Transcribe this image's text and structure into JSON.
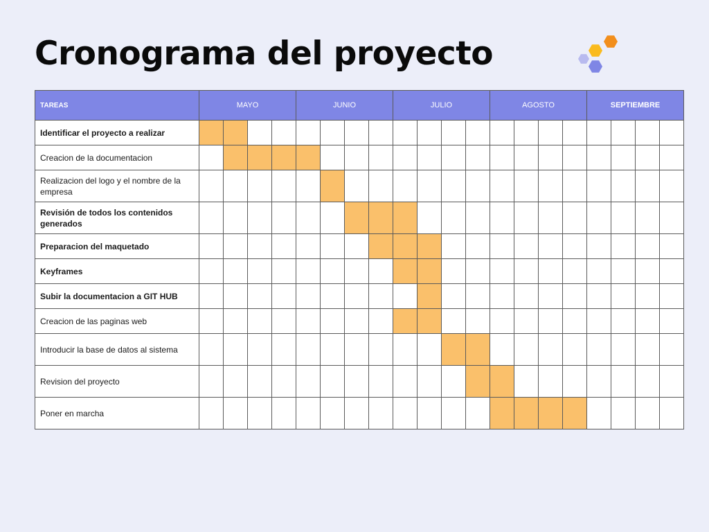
{
  "title": "Cronograma del proyecto",
  "colors": {
    "background": "#ECEEF9",
    "header": "#7F86E5",
    "bar": "#FAC06B",
    "logo_hexes": [
      "#F28E1C",
      "#FABB1E",
      "#B8BAEF",
      "#7F86E5"
    ]
  },
  "table": {
    "task_header": "TAREAS",
    "months": [
      {
        "label": "MAYO",
        "bold": false
      },
      {
        "label": "JUNIO",
        "bold": false
      },
      {
        "label": "JULIO",
        "bold": false
      },
      {
        "label": "AGOSTO",
        "bold": false
      },
      {
        "label": "SEPTIEMBRE",
        "bold": true
      }
    ],
    "weeks_per_month": 4,
    "rows": [
      {
        "task": "Identificar el proyecto a realizar",
        "bold": true,
        "weeks": [
          1,
          2
        ]
      },
      {
        "task": "Creacion de la documentacion",
        "bold": false,
        "weeks": [
          2,
          3,
          4,
          5
        ]
      },
      {
        "task": "Realizacion del logo y el nombre de la empresa",
        "bold": false,
        "weeks": [
          6
        ]
      },
      {
        "task": "Revisión de todos los  contenidos generados",
        "bold": true,
        "weeks": [
          7,
          8,
          9
        ]
      },
      {
        "task": "Preparacion del maquetado",
        "bold": true,
        "weeks": [
          8,
          9,
          10
        ]
      },
      {
        "task": "Keyframes",
        "bold": true,
        "weeks": [
          9,
          10
        ]
      },
      {
        "task": "Subir la documentacion a GIT HUB",
        "bold": true,
        "weeks": [
          10
        ]
      },
      {
        "task": "Creacion de las paginas web",
        "bold": false,
        "weeks": [
          9,
          10
        ]
      },
      {
        "task": "Introducir la base de datos al sistema",
        "bold": false,
        "weeks": [
          11,
          12
        ]
      },
      {
        "task": "Revision del proyecto",
        "bold": false,
        "weeks": [
          12,
          13
        ]
      },
      {
        "task": "Poner en marcha",
        "bold": false,
        "weeks": [
          13,
          14,
          15,
          16
        ]
      }
    ]
  }
}
